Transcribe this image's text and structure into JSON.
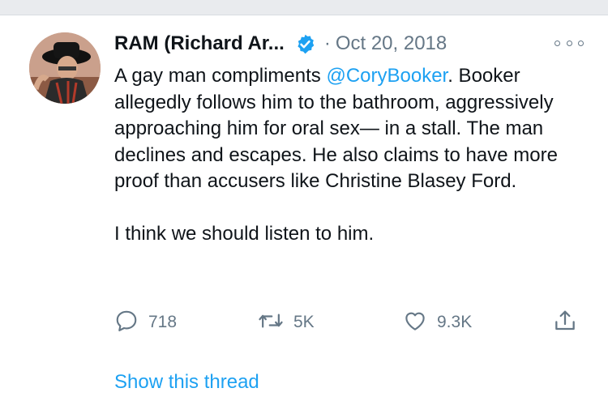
{
  "tweet": {
    "author_name": "RAM (Richard Ar...",
    "separator": "·",
    "date": "Oct 20, 2018",
    "text_part1": "A gay man compliments ",
    "mention": "@CoryBooker",
    "text_part2": ". Booker allegedly follows him to the bathroom, aggressively approaching him for oral sex— in a stall. The man declines and escapes. He also claims to have more proof than accusers like Christine Blasey Ford.",
    "text_paragraph2": "I think we should listen to him.",
    "replies": "718",
    "retweets": "5K",
    "likes": "9.3K",
    "show_thread": "Show this thread"
  },
  "icons": {
    "verified": "verified-badge-icon",
    "more": "more-options-icon",
    "reply": "reply-icon",
    "retweet": "retweet-icon",
    "like": "heart-icon",
    "share": "share-icon"
  },
  "colors": {
    "accent": "#1da1f2",
    "secondary_text": "#657786",
    "primary_text": "#0f1419",
    "top_bar": "#e9ebee"
  }
}
